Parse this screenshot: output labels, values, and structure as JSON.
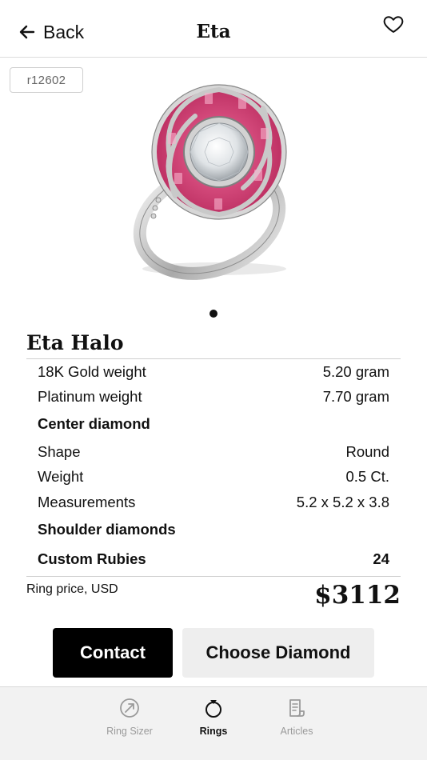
{
  "header": {
    "back_label": "Back",
    "title": "Eta"
  },
  "product": {
    "sku": "r12602",
    "name": "Eta Halo"
  },
  "specs": {
    "gold_weight": {
      "label": "18K Gold weight",
      "value": "5.20 gram"
    },
    "platinum_weight": {
      "label": "Platinum weight",
      "value": "7.70 gram"
    },
    "center_heading": "Center diamond",
    "shape": {
      "label": "Shape",
      "value": "Round"
    },
    "weight": {
      "label": "Weight",
      "value": "0.5 Ct."
    },
    "measurements": {
      "label": "Measurements",
      "value": "5.2 x 5.2 x 3.8"
    },
    "shoulder_heading": "Shoulder diamonds",
    "custom_rubies": {
      "label": "Custom Rubies",
      "value": "24"
    }
  },
  "price": {
    "label": "Ring price, USD",
    "value": "$3112"
  },
  "actions": {
    "contact_label": "Contact",
    "choose_label": "Choose Diamond"
  },
  "tabs": [
    {
      "label": "Ring Sizer",
      "icon": "ring-sizer-icon",
      "active": false
    },
    {
      "label": "Rings",
      "icon": "ring-icon",
      "active": true
    },
    {
      "label": "Articles",
      "icon": "articles-icon",
      "active": false
    }
  ],
  "colors": {
    "accent": "#000000",
    "ruby": "#d9457a",
    "secondary_button": "#eeeeee",
    "tabbar_bg": "#f2f2f2",
    "inactive_tab": "#9a9a9a"
  }
}
